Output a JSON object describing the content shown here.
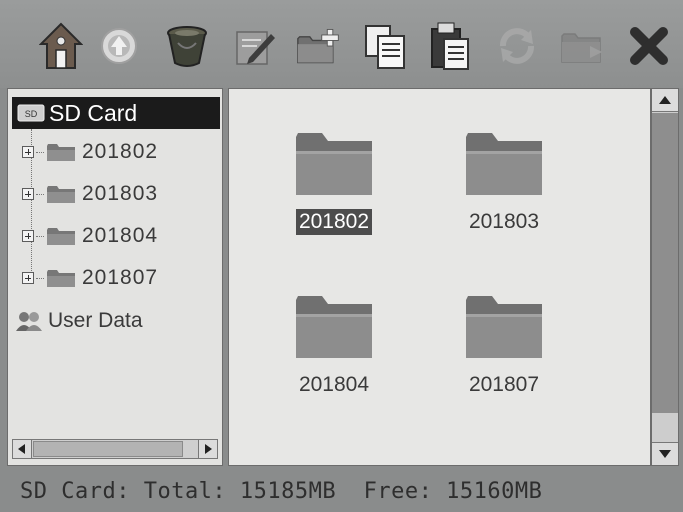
{
  "toolbar": {
    "buttons": [
      {
        "id": "home",
        "icon": "home-icon",
        "enabled": true
      },
      {
        "id": "up",
        "icon": "up-level-icon",
        "enabled": true
      },
      {
        "id": "recycle",
        "icon": "recycle-bin-icon",
        "enabled": true
      },
      {
        "id": "rename",
        "icon": "rename-icon",
        "enabled": true
      },
      {
        "id": "new-folder",
        "icon": "new-folder-icon",
        "enabled": true
      },
      {
        "id": "copy",
        "icon": "copy-icon",
        "enabled": true
      },
      {
        "id": "paste",
        "icon": "paste-icon",
        "enabled": true
      },
      {
        "id": "refresh",
        "icon": "refresh-icon",
        "enabled": false
      },
      {
        "id": "move",
        "icon": "move-folder-icon",
        "enabled": false
      },
      {
        "id": "close",
        "icon": "close-icon",
        "enabled": true
      }
    ]
  },
  "tree": {
    "root_label": "SD Card",
    "root_icon": "sd-card-icon",
    "items": [
      {
        "label": "201802",
        "icon": "folder-icon"
      },
      {
        "label": "201803",
        "icon": "folder-icon"
      },
      {
        "label": "201804",
        "icon": "folder-icon"
      },
      {
        "label": "201807",
        "icon": "folder-icon"
      }
    ],
    "user_data_label": "User Data",
    "user_data_icon": "user-data-icon"
  },
  "content": {
    "folders": [
      {
        "label": "201802",
        "selected": true
      },
      {
        "label": "201803",
        "selected": false
      },
      {
        "label": "201804",
        "selected": false
      },
      {
        "label": "201807",
        "selected": false
      }
    ]
  },
  "status": {
    "text": "SD Card: Total: 15185MB  Free: 15160MB"
  },
  "colors": {
    "chrome": "#8a8c8c",
    "pane": "#e5e5e3",
    "selection": "#4d4d4d",
    "folder": "#8d8d8d"
  }
}
